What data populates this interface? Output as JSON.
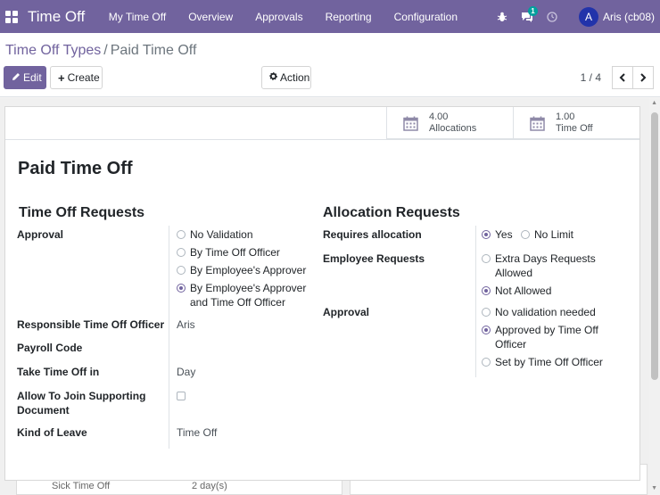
{
  "navbar": {
    "app_name": "Time Off",
    "menu": [
      "My Time Off",
      "Overview",
      "Approvals",
      "Reporting",
      "Configuration"
    ],
    "message_count": "1",
    "avatar_letter": "A",
    "user_name": "Aris (cb08)"
  },
  "breadcrumb": {
    "parent": "Time Off Types",
    "separator": "/",
    "current": "Paid Time Off"
  },
  "toolbar": {
    "edit_label": "Edit",
    "create_label": "Create",
    "action_label": "Action",
    "pager": "1 / 4"
  },
  "stat_buttons": [
    {
      "value": "4.00",
      "label": "Allocations"
    },
    {
      "value": "1.00",
      "label": "Time Off"
    }
  ],
  "form": {
    "title": "Paid Time Off",
    "time_off_requests": {
      "heading": "Time Off Requests",
      "approval_label": "Approval",
      "approval_options": [
        "No Validation",
        "By Time Off Officer",
        "By Employee's Approver",
        "By Employee's Approver",
        "and Time Off Officer"
      ],
      "responsible_label": "Responsible Time Off Officer",
      "responsible_value": "Aris",
      "payroll_label": "Payroll Code",
      "payroll_value": "",
      "take_label": "Take Time Off in",
      "take_value": "Day",
      "allow_label_1": "Allow To Join Supporting",
      "allow_label_2": "Document",
      "kind_label": "Kind of Leave",
      "kind_value": "Time Off"
    },
    "allocation_requests": {
      "heading": "Allocation Requests",
      "requires_label": "Requires allocation",
      "requires_yes": "Yes",
      "requires_no_limit": "No Limit",
      "employee_label": "Employee Requests",
      "employee_options": [
        "Extra Days Requests",
        "Allowed",
        "Not Allowed"
      ],
      "approval_label": "Approval",
      "approval_options": [
        "No validation needed",
        "Approved by Time Off",
        "Officer",
        "Set by Time Off Officer"
      ]
    }
  },
  "background": {
    "row_name": "Sick Time Off",
    "row_value": "2 day(s)"
  },
  "colors": {
    "brand": "#71639e",
    "badge": "#00a09d"
  }
}
